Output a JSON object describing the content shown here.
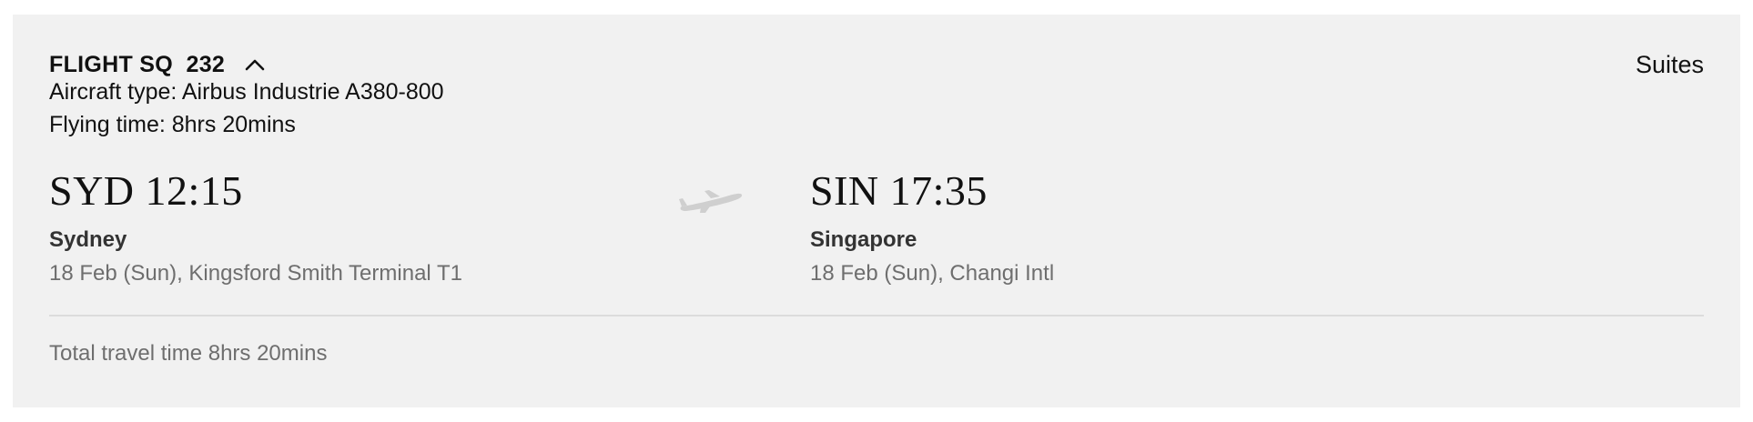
{
  "flight": {
    "number_label": "FLIGHT SQ  232",
    "cabin_class": "Suites",
    "aircraft_type": "Aircraft type: Airbus Industrie A380-800",
    "flying_time": "Flying time: 8hrs 20mins",
    "expand_icon": "chevron-up-icon"
  },
  "departure": {
    "time_line": "SYD 12:15",
    "city": "Sydney",
    "info": "18 Feb (Sun), Kingsford Smith Terminal T1"
  },
  "arrival": {
    "time_line": "SIN 17:35",
    "city": "Singapore",
    "info": "18 Feb (Sun), Changi Intl"
  },
  "route_icon": "airplane-icon",
  "summary": {
    "total_travel_time": "Total travel time 8hrs 20mins"
  },
  "colors": {
    "card_background": "#f1f1f1",
    "primary_text": "#111111",
    "secondary_text": "#6e6e6e",
    "divider": "#dcdcdc",
    "plane_icon": "#cfcfcf"
  }
}
